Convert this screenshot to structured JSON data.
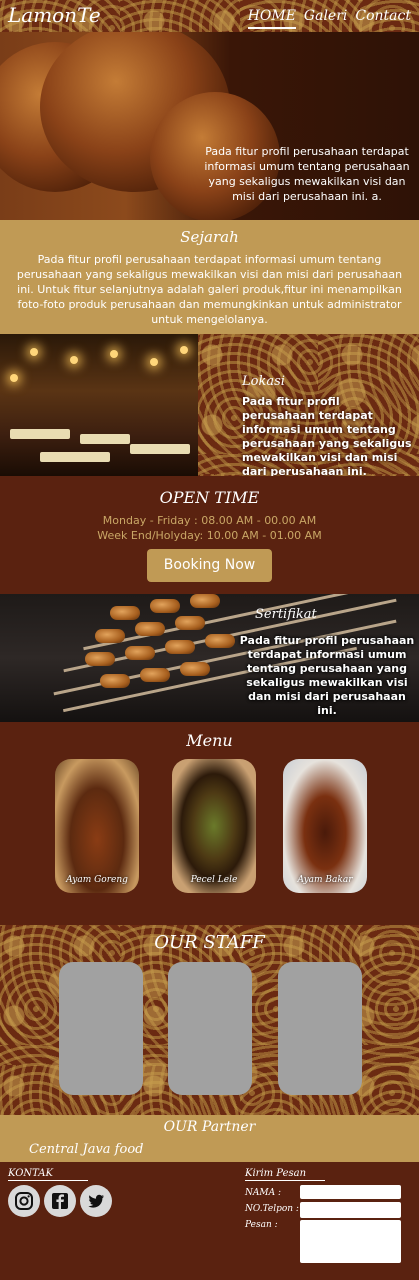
{
  "header": {
    "brand": "LamonTe",
    "nav": [
      "HOME",
      "Galeri",
      "Contact"
    ]
  },
  "hero": {
    "text": "Pada fitur profil perusahaan terdapat informasi umum tentang perusahaan yang sekaligus mewakilkan visi dan misi dari perusahaan ini. a."
  },
  "sejarah": {
    "title": "Sejarah",
    "text": "Pada fitur profil perusahaan terdapat informasi umum tentang perusahaan yang sekaligus mewakilkan visi dan misi dari perusahaan ini. Untuk fitur selanjutnya adalah galeri produk,fitur ini menampilkan foto-foto produk perusahaan dan memungkinkan untuk administrator untuk mengelolanya."
  },
  "lokasi": {
    "title": "Lokasi",
    "text": "Pada fitur profil perusahaan terdapat informasi umum tentang perusahaan yang sekaligus mewakilkan visi dan misi dari perusahaan ini."
  },
  "open_time": {
    "title": "OPEN TIME",
    "weekday": "Monday - Friday : 08.00 AM - 00.00 AM",
    "weekend": "Week End/Holyday: 10.00 AM - 01.00 AM",
    "booking_label": "Booking Now"
  },
  "sertifikat": {
    "title": "Sertifikat",
    "text": "Pada fitur profil perusahaan terdapat informasi umum tentang perusahaan yang sekaligus mewakilkan visi dan misi dari perusahaan ini."
  },
  "menu": {
    "title": "Menu",
    "items": [
      {
        "label": "Ayam Goreng"
      },
      {
        "label": "Pecel Lele"
      },
      {
        "label": "Ayam Bakar"
      }
    ]
  },
  "staff": {
    "title": "OUR STAFF"
  },
  "partner": {
    "title": "OUR Partner",
    "name": "Central Java food"
  },
  "footer": {
    "kontak_title": "KONTAK",
    "form_title": "Kirim Pesan",
    "nama_label": "NAMA :",
    "telp_label": "NO.Telpon :",
    "pesan_label": "Pesan :"
  },
  "colors": {
    "brown": "#5a2210",
    "gold": "#c09a55",
    "staff_placeholder": "#a1a1a1"
  }
}
